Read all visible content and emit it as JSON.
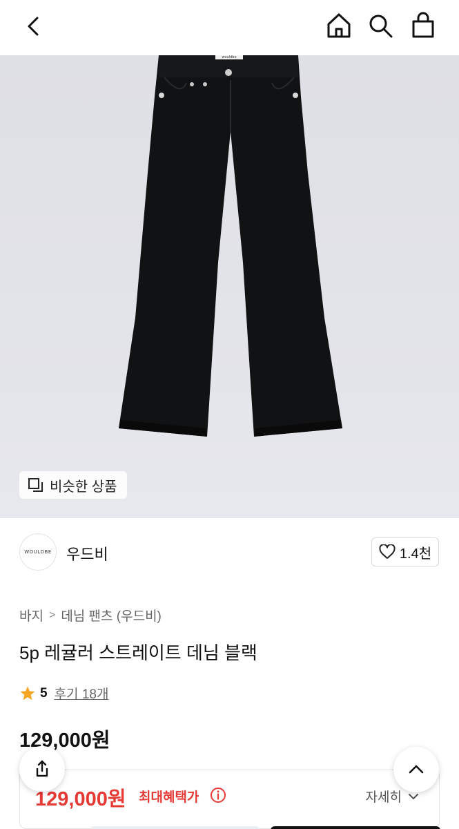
{
  "header": {
    "back_icon": "chevron-left-icon",
    "home_icon": "home-icon",
    "search_icon": "search-icon",
    "bag_icon": "shopping-bag-icon"
  },
  "product_image": {
    "waistband_label": "wouldbe",
    "similar_button_label": "비슷한 상품",
    "similar_icon": "similar-items-icon"
  },
  "brand": {
    "logo_text": "WOULDBE",
    "name": "우드비",
    "like_count": "1.4천",
    "like_icon": "heart-icon"
  },
  "breadcrumb": {
    "category": "바지",
    "separator": ">",
    "subcategory": "데님 팬츠 (우드비)"
  },
  "product": {
    "title": "5p 레귤러 스트레이트 데님 블랙",
    "rating": "5",
    "review_label": "후기 18개",
    "price": "129,000원"
  },
  "benefit": {
    "price": "129,000원",
    "label": "최대혜택가",
    "detail_label": "자세히"
  },
  "colors": {
    "accent_red": "#e53935",
    "star": "#f6a623",
    "text": "#111111"
  }
}
